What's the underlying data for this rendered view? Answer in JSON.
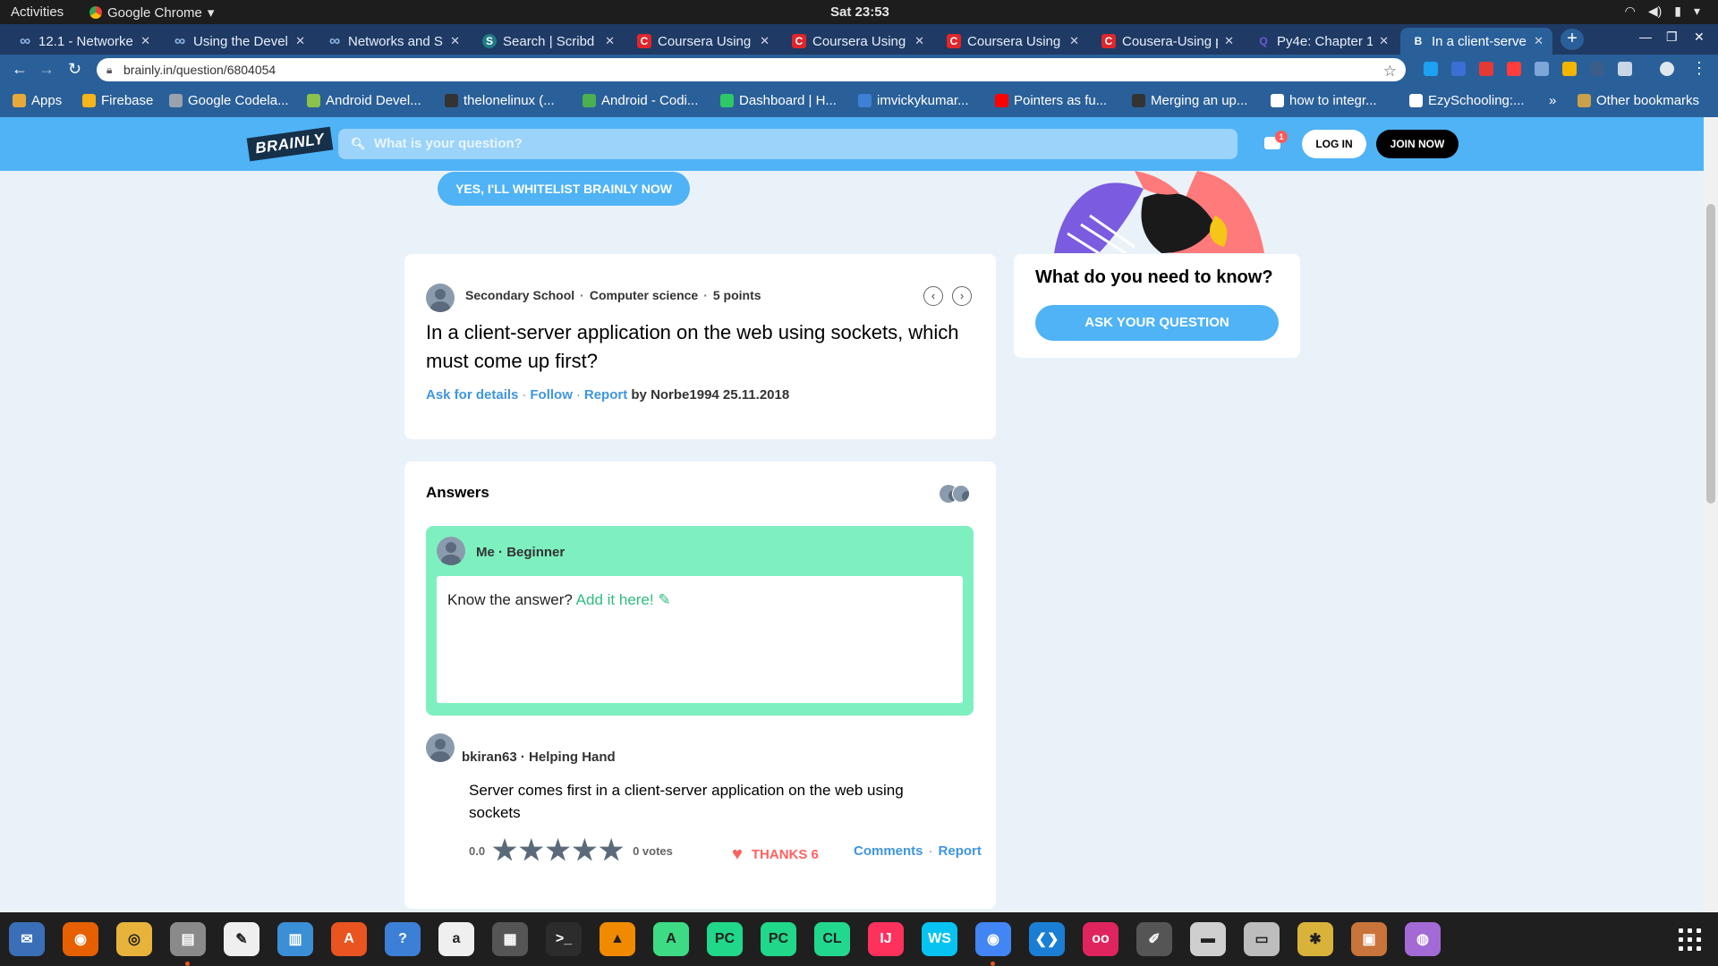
{
  "system": {
    "activities": "Activities",
    "app_name": "Google Chrome",
    "clock": "Sat 23:53"
  },
  "tabs": [
    {
      "title": "12.1 - Networke",
      "icon": "coursera-infinity-icon",
      "color": "#8fb6e8"
    },
    {
      "title": "Using the Devel",
      "icon": "coursera-infinity-icon",
      "color": "#8fb6e8"
    },
    {
      "title": "Networks and S",
      "icon": "coursera-infinity-icon",
      "color": "#8fb6e8"
    },
    {
      "title": "Search | Scribd",
      "icon": "scribd-icon",
      "color": "#1e7b85"
    },
    {
      "title": "Coursera Using",
      "icon": "coursera-c-icon",
      "color": "#e0262b"
    },
    {
      "title": "Coursera Using",
      "icon": "coursera-c-icon",
      "color": "#e0262b"
    },
    {
      "title": "Coursera Using",
      "icon": "coursera-c-icon",
      "color": "#e0262b"
    },
    {
      "title": "Cousera-Using p",
      "icon": "coursera-c-icon",
      "color": "#e0262b"
    },
    {
      "title": "Py4e: Chapter 1",
      "icon": "py4e-icon",
      "color": "#6b5bd6"
    },
    {
      "title": "In a client-serve",
      "icon": "brainly-b-icon",
      "color": "#ffffff"
    }
  ],
  "address_bar": {
    "url": "brainly.in/question/6804054"
  },
  "bookmarks": [
    {
      "label": "Apps",
      "color": "#e8a93b"
    },
    {
      "label": "Firebase",
      "color": "#f6b518"
    },
    {
      "label": "Google Codela...",
      "color": "#9aa3ad"
    },
    {
      "label": "Android Devel...",
      "color": "#8bc34a"
    },
    {
      "label": "thelonelinux (...",
      "color": "#333333"
    },
    {
      "label": "Android - Codi...",
      "color": "#4caf50"
    },
    {
      "label": "Dashboard | H...",
      "color": "#2ec866"
    },
    {
      "label": "imvickykumar...",
      "color": "#3f7fd6"
    },
    {
      "label": "Pointers as fu...",
      "color": "#ff0000"
    },
    {
      "label": "Merging an up...",
      "color": "#333333"
    },
    {
      "label": "how to integr...",
      "color": "#ffffff"
    },
    {
      "label": "EzySchooling:...",
      "color": "#ffffff"
    },
    {
      "label": "Other bookmarks",
      "color": "#c9a04b"
    }
  ],
  "bookmarks_more": "»",
  "brainly": {
    "logo": "BRAINLY",
    "search_placeholder": "What is your question?",
    "notif_count": "1",
    "login": "LOG IN",
    "join": "JOIN NOW",
    "whitelist": "YES, I'LL WHITELIST BRAINLY NOW"
  },
  "question": {
    "level": "Secondary School",
    "subject": "Computer science",
    "points": "5 points",
    "text": "In a client-server application on the web using sockets, which must come up first?",
    "ask_details": "Ask for details",
    "follow": "Follow",
    "report": "Report",
    "byline": "by Norbe1994 25.11.2018"
  },
  "ask_box": {
    "title": "What do you need to know?",
    "button": "ASK YOUR QUESTION"
  },
  "answers": {
    "heading": "Answers",
    "me_user": "Me",
    "me_rank": "Beginner",
    "know_answer": "Know the answer?",
    "add_it": "Add it here!",
    "answer": {
      "user": "bkiran63",
      "rank": "Helping Hand",
      "text": "Server comes first in a client-server application on the web using sockets",
      "rating": "0.0",
      "votes": "0 votes",
      "thanks": "THANKS 6",
      "comments": "Comments",
      "report": "Report"
    }
  },
  "dock": [
    {
      "icon": "thunderbird-icon",
      "color": "#3a6fb8",
      "glyph": "✉"
    },
    {
      "icon": "firefox-icon",
      "color": "#e66000",
      "glyph": "◉"
    },
    {
      "icon": "rhythmbox-icon",
      "color": "#e8b33a",
      "glyph": "◎"
    },
    {
      "icon": "files-icon",
      "color": "#8a8a8a",
      "glyph": "▤"
    },
    {
      "icon": "text-editor-icon",
      "color": "#efefef",
      "glyph": "✎"
    },
    {
      "icon": "libreoffice-writer-icon",
      "color": "#3b8fd6",
      "glyph": "▥"
    },
    {
      "icon": "software-center-icon",
      "color": "#e95420",
      "glyph": "A"
    },
    {
      "icon": "help-icon",
      "color": "#3c7fd6",
      "glyph": "?"
    },
    {
      "icon": "amazon-icon",
      "color": "#efefef",
      "glyph": "a"
    },
    {
      "icon": "video-editor-icon",
      "color": "#555555",
      "glyph": "▦"
    },
    {
      "icon": "terminal-icon",
      "color": "#2c2c2c",
      "glyph": ">_"
    },
    {
      "icon": "vlc-icon",
      "color": "#f08a00",
      "glyph": "▲"
    },
    {
      "icon": "android-studio-icon",
      "color": "#3ddc84",
      "glyph": "A"
    },
    {
      "icon": "pycharm-ce-icon",
      "color": "#21d789",
      "glyph": "PC"
    },
    {
      "icon": "pycharm-pro-icon",
      "color": "#21d789",
      "glyph": "PC"
    },
    {
      "icon": "clion-icon",
      "color": "#22d88f",
      "glyph": "CL"
    },
    {
      "icon": "intellij-icon",
      "color": "#fe315d",
      "glyph": "IJ"
    },
    {
      "icon": "webstorm-icon",
      "color": "#07c3f2",
      "glyph": "WS"
    },
    {
      "icon": "chrome-icon",
      "color": "#4285f4",
      "glyph": "◉"
    },
    {
      "icon": "vscode-icon",
      "color": "#1a7fd4",
      "glyph": "❮❯"
    },
    {
      "icon": "screen-recorder-icon",
      "color": "#e0245e",
      "glyph": "oo"
    },
    {
      "icon": "color-picker-icon",
      "color": "#555555",
      "glyph": "✐"
    },
    {
      "icon": "printer-icon",
      "color": "#cfcfcf",
      "glyph": "▬"
    },
    {
      "icon": "scanner-icon",
      "color": "#bdbdbd",
      "glyph": "▭"
    },
    {
      "icon": "image-viewer-icon",
      "color": "#d9b23a",
      "glyph": "✱"
    },
    {
      "icon": "archive-manager-icon",
      "color": "#c9743a",
      "glyph": "▣"
    },
    {
      "icon": "webcam-icon",
      "color": "#a36ad6",
      "glyph": "◍"
    }
  ]
}
